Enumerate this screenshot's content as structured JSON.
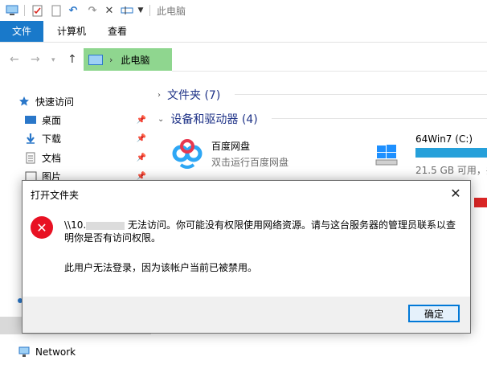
{
  "titlebar": {
    "title": "此电脑"
  },
  "ribbon": {
    "tabs": [
      "文件",
      "计算机",
      "查看"
    ]
  },
  "address": {
    "crumb": "此电脑"
  },
  "sidebar": {
    "quick_access": "快速访问",
    "items": [
      {
        "label": "桌面",
        "pinned": true
      },
      {
        "label": "下载",
        "pinned": true
      },
      {
        "label": "文档",
        "pinned": true
      },
      {
        "label": "图片",
        "pinned": true
      }
    ],
    "network": "Network"
  },
  "main": {
    "folders_header": "文件夹 (7)",
    "devices_header": "设备和驱动器 (4)",
    "baidu": {
      "name": "百度网盘",
      "sub": "双击运行百度网盘"
    },
    "drive_c": {
      "name": "64Win7 (C:)",
      "sub": "21.5 GB 可用，共"
    }
  },
  "dialog": {
    "title": "打开文件夹",
    "msg_prefix": "\\\\10.",
    "msg_rest": "无法访问。你可能没有权限使用网络资源。请与这台服务器的管理员联系以查明你是否有访问权限。",
    "msg2": "此用户无法登录，因为该帐户当前已被禁用。",
    "ok_label": "确定"
  },
  "colors": {
    "accent": "#1979ca",
    "address_highlight": "#8fd68f",
    "error": "#e81123",
    "capacity": "#26a0da"
  }
}
